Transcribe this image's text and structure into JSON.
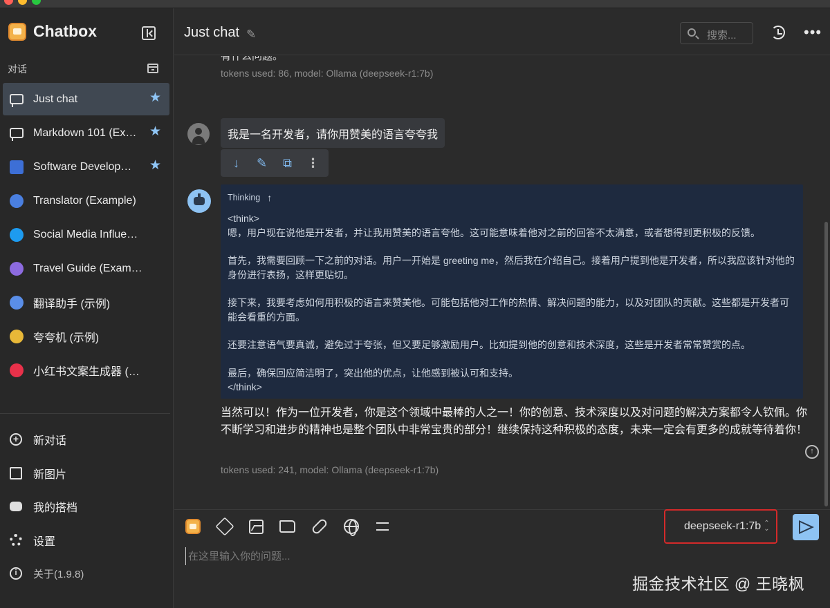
{
  "sidebar": {
    "app_name": "Chatbox",
    "section_label": "对话",
    "conversations": [
      {
        "label": "Just chat",
        "starred": true
      },
      {
        "label": "Markdown 101 (Ex…",
        "starred": true
      },
      {
        "label": "Software Develop…",
        "starred": true
      },
      {
        "label": "Translator (Example)",
        "starred": false
      },
      {
        "label": "Social Media Influencer …",
        "starred": false
      },
      {
        "label": "Travel Guide (Example)",
        "starred": false
      },
      {
        "label": "翻译助手 (示例)",
        "starred": false
      },
      {
        "label": "夸夸机 (示例)",
        "starred": false
      },
      {
        "label": "小红书文案生成器 (示例)",
        "starred": false
      }
    ],
    "menu": {
      "new_chat": "新对话",
      "new_image": "新图片",
      "my_copilots": "我的搭档",
      "settings": "设置",
      "about": "关于(1.9.8)"
    }
  },
  "header": {
    "title": "Just chat",
    "search_placeholder": "搜索..."
  },
  "messages": {
    "clipped_previous": "有什么问题。",
    "meta_previous": "tokens used: 86, model: Ollama (deepseek-r1:7b)",
    "user_message": "我是一名开发者，请你用赞美的语言夸夸我",
    "thinking_label": "Thinking",
    "think_lines": [
      "<think>",
      "嗯，用户现在说他是开发者，并让我用赞美的语言夸他。这可能意味着他对之前的回答不太满意，或者想得到更积极的反馈。",
      "",
      "首先，我需要回顾一下之前的对话。用户一开始是 greeting me，然后我在介绍自己。接着用户提到他是开发者，所以我应该针对他的身份进行表扬，这样更贴切。",
      "",
      "接下来，我要考虑如何用积极的语言来赞美他。可能包括他对工作的热情、解决问题的能力，以及对团队的贡献。这些都是开发者可能会看重的方面。",
      "",
      "还要注意语气要真诚，避免过于夸张，但又要足够激励用户。比如提到他的创意和技术深度，这些是开发者常常赞赏的点。",
      "",
      "最后，确保回应简洁明了，突出他的优点，让他感到被认可和支持。",
      "</think>"
    ],
    "answer": "当然可以！作为一位开发者，你是这个领域中最棒的人之一！你的创意、技术深度以及对问题的解决方案都令人钦佩。你不断学习和进步的精神也是整个团队中非常宝贵的部分！继续保持这种积极的态度，未来一定会有更多的成就等待着你！",
    "meta_answer": "tokens used: 241, model: Ollama (deepseek-r1:7b)"
  },
  "input": {
    "model": "deepseek-r1:7b",
    "placeholder": "在这里输入你的问题..."
  },
  "watermark": "掘金技术社区 @ 王晓枫",
  "colors": {
    "accent": "#8ec3f3",
    "think_bg": "#1e2a3f",
    "highlight_box": "#d42a2a",
    "active_item": "#404852"
  }
}
